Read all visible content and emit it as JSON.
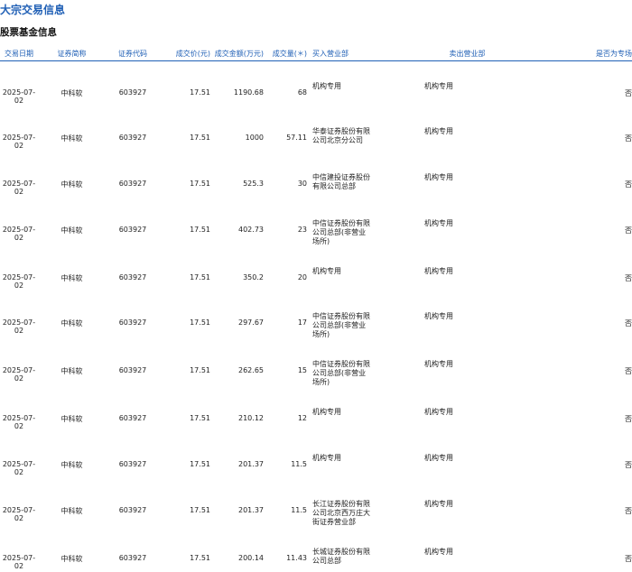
{
  "header": {
    "title": "大宗交易信息",
    "section": "股票基金信息"
  },
  "columns": [
    "交易日期",
    "证券简称",
    "证券代码",
    "成交价(元)",
    "成交金额(万元)",
    "成交量(＊)",
    "买入营业部",
    "卖出营业部",
    "是否为专场"
  ],
  "rows": [
    {
      "date": "2025-07-02",
      "name": "中科软",
      "code": "603927",
      "price": "17.51",
      "amount": "1190.68",
      "volume": "68",
      "buyer": [
        "机构专用"
      ],
      "seller": "机构专用",
      "special": "否"
    },
    {
      "date": "2025-07-02",
      "name": "中科软",
      "code": "603927",
      "price": "17.51",
      "amount": "1000",
      "volume": "57.11",
      "buyer": [
        "华泰证券股份有限",
        "公司北京分公司"
      ],
      "seller": "机构专用",
      "special": "否"
    },
    {
      "date": "2025-07-02",
      "name": "中科软",
      "code": "603927",
      "price": "17.51",
      "amount": "525.3",
      "volume": "30",
      "buyer": [
        "中信建投证券股份",
        "有限公司总部"
      ],
      "seller": "机构专用",
      "special": "否"
    },
    {
      "date": "2025-07-02",
      "name": "中科软",
      "code": "603927",
      "price": "17.51",
      "amount": "402.73",
      "volume": "23",
      "buyer": [
        "中信证券股份有限",
        "公司总部(非营业",
        "场所)"
      ],
      "seller": "机构专用",
      "special": "否"
    },
    {
      "date": "2025-07-02",
      "name": "中科软",
      "code": "603927",
      "price": "17.51",
      "amount": "350.2",
      "volume": "20",
      "buyer": [
        "机构专用"
      ],
      "seller": "机构专用",
      "special": "否"
    },
    {
      "date": "2025-07-02",
      "name": "中科软",
      "code": "603927",
      "price": "17.51",
      "amount": "297.67",
      "volume": "17",
      "buyer": [
        "中信证券股份有限",
        "公司总部(非营业",
        "场所)"
      ],
      "seller": "机构专用",
      "special": "否"
    },
    {
      "date": "2025-07-02",
      "name": "中科软",
      "code": "603927",
      "price": "17.51",
      "amount": "262.65",
      "volume": "15",
      "buyer": [
        "中信证券股份有限",
        "公司总部(非营业",
        "场所)"
      ],
      "seller": "机构专用",
      "special": "否"
    },
    {
      "date": "2025-07-02",
      "name": "中科软",
      "code": "603927",
      "price": "17.51",
      "amount": "210.12",
      "volume": "12",
      "buyer": [
        "机构专用"
      ],
      "seller": "机构专用",
      "special": "否"
    },
    {
      "date": "2025-07-02",
      "name": "中科软",
      "code": "603927",
      "price": "17.51",
      "amount": "201.37",
      "volume": "11.5",
      "buyer": [
        "机构专用"
      ],
      "seller": "机构专用",
      "special": "否"
    },
    {
      "date": "2025-07-02",
      "name": "中科软",
      "code": "603927",
      "price": "17.51",
      "amount": "201.37",
      "volume": "11.5",
      "buyer": [
        "长江证券股份有限",
        "公司北京西万庄大",
        "街证券营业部"
      ],
      "seller": "机构专用",
      "special": "否"
    },
    {
      "date": "2025-07-02",
      "name": "中科软",
      "code": "603927",
      "price": "17.51",
      "amount": "200.14",
      "volume": "11.43",
      "buyer": [
        "长城证券股份有限",
        "公司总部"
      ],
      "seller": "机构专用",
      "special": "否"
    }
  ],
  "colors": {
    "accent": "#1f5fb5"
  }
}
